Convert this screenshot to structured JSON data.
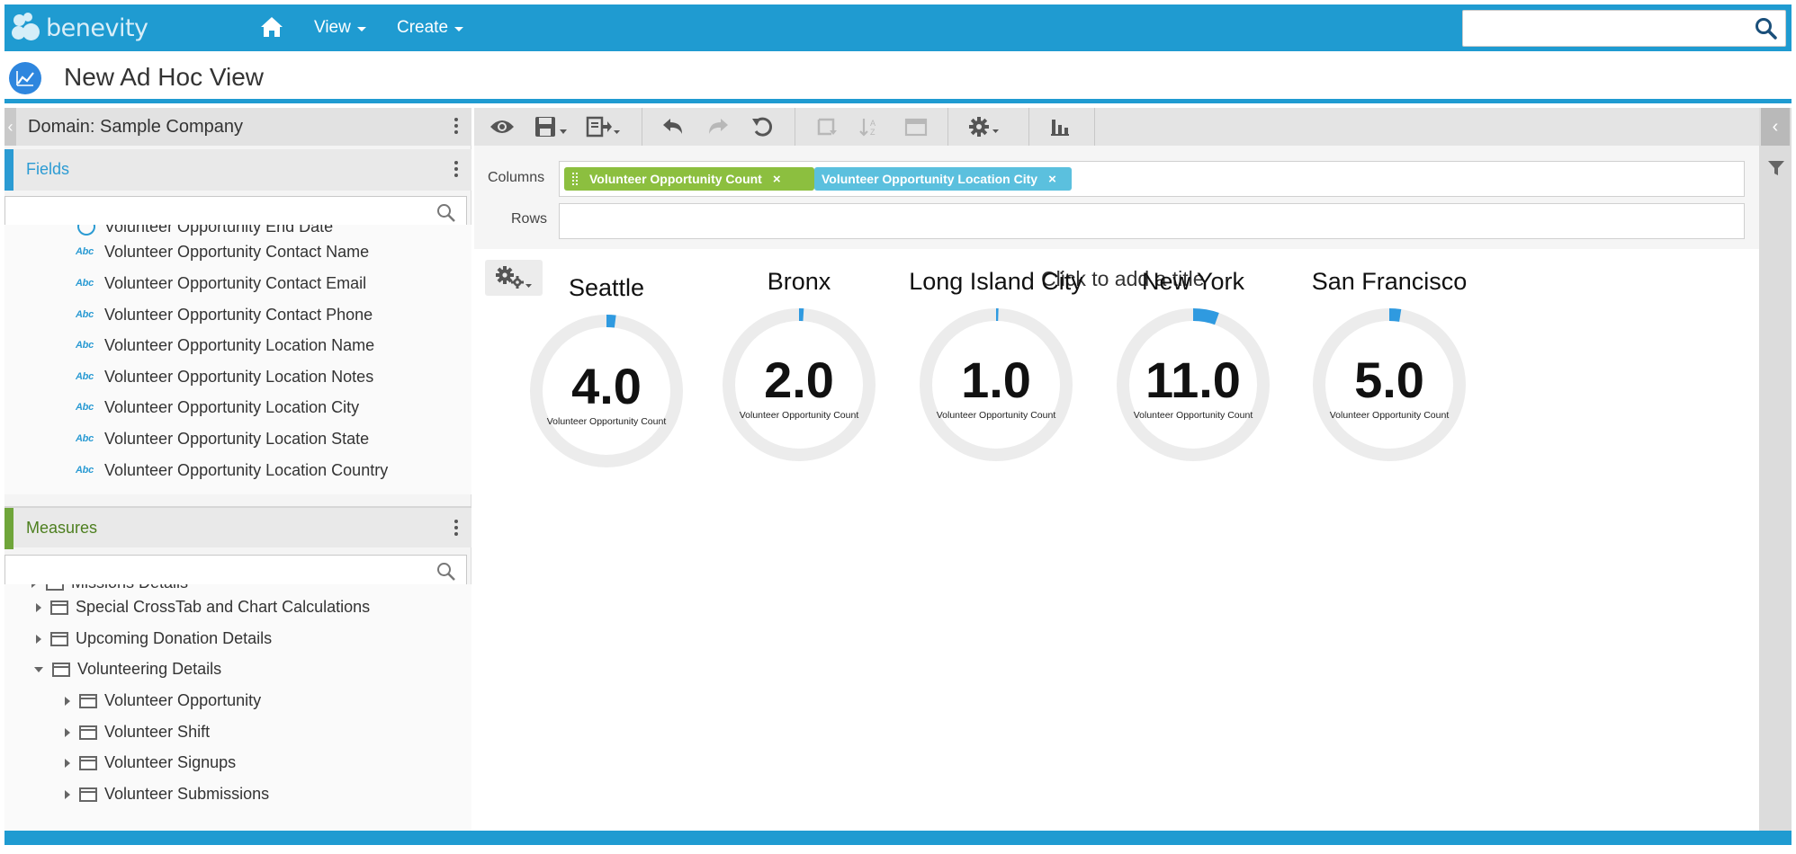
{
  "header": {
    "logo_text": "benevity",
    "nav": [
      {
        "label": "View"
      },
      {
        "label": "Create"
      }
    ],
    "search_placeholder": ""
  },
  "page": {
    "title": "New Ad Hoc View"
  },
  "left_panel": {
    "domain_label": "Domain: Sample Company",
    "fields_label": "Fields",
    "fields": [
      "Volunteer Opportunity End Date",
      "Volunteer Opportunity Contact Name",
      "Volunteer Opportunity Contact Email",
      "Volunteer Opportunity Contact Phone",
      "Volunteer Opportunity Location Name",
      "Volunteer Opportunity Location Notes",
      "Volunteer Opportunity Location City",
      "Volunteer Opportunity Location State",
      "Volunteer Opportunity Location Country"
    ],
    "field_type_tag": "Abc",
    "measures_label": "Measures",
    "measures": [
      {
        "label": "Missions Details"
      },
      {
        "label": "Special CrossTab and Chart Calculations"
      },
      {
        "label": "Upcoming Donation Details"
      },
      {
        "label": "Volunteering Details"
      },
      {
        "label": "Volunteer Opportunity"
      },
      {
        "label": "Volunteer Shift"
      },
      {
        "label": "Volunteer Signups"
      },
      {
        "label": "Volunteer Submissions"
      }
    ]
  },
  "designer": {
    "columns_label": "Columns",
    "rows_label": "Rows",
    "column_pills": [
      {
        "label": "Volunteer Opportunity Count",
        "color": "#8cbf3f"
      },
      {
        "label": "Volunteer Opportunity Location City",
        "color": "#5bc0de"
      }
    ],
    "pill_remove": "×"
  },
  "canvas": {
    "title_prompt": "Click to add a title"
  },
  "colors": {
    "brand_blue": "#1f9bd1",
    "fields_accent": "#2b9bd3",
    "measures_accent": "#6fa53a",
    "gauge_track": "#ececec",
    "gauge_fill": "#2f9ae0"
  },
  "chart_data": {
    "type": "gauge",
    "title": "",
    "metric": "Volunteer Opportunity Count",
    "max": 100,
    "series": [
      {
        "category": "Seattle",
        "value": 4.0,
        "label": "4.0"
      },
      {
        "category": "Bronx",
        "value": 2.0,
        "label": "2.0"
      },
      {
        "category": "Long Island City",
        "value": 1.0,
        "label": "1.0"
      },
      {
        "category": "New York",
        "value": 11.0,
        "label": "11.0"
      },
      {
        "category": "San Francisco",
        "value": 5.0,
        "label": "5.0"
      }
    ]
  }
}
